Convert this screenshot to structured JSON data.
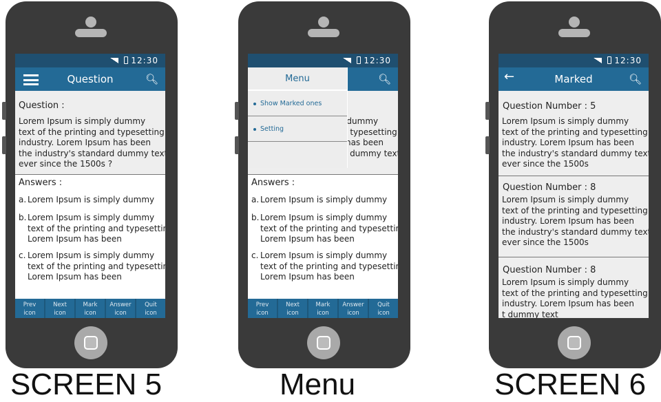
{
  "status": {
    "time": "12:30"
  },
  "screen5": {
    "title": "Question",
    "question_heading": "Question :",
    "question_lines": [
      "Lorem Ipsum is simply dummy",
      "text of the printing and typesetting",
      "industry. Lorem Ipsum has been",
      "the industry's standard dummy text",
      "ever since the 1500s ?"
    ],
    "answers_heading": "Answers :",
    "answers": [
      {
        "letter": "a.",
        "lines": [
          "Lorem Ipsum is simply dummy"
        ]
      },
      {
        "letter": "b.",
        "lines": [
          "Lorem Ipsum is simply dummy",
          "text of the printing and typesetting",
          "Lorem Ipsum has been"
        ]
      },
      {
        "letter": "c.",
        "lines": [
          "Lorem Ipsum is simply dummy",
          "text of the printing and typesetting",
          "Lorem Ipsum has been"
        ]
      }
    ],
    "nav": [
      [
        "Prev",
        "icon"
      ],
      [
        "Next",
        "icon"
      ],
      [
        "Mark",
        "icon"
      ],
      [
        "Answer",
        "icon"
      ],
      [
        "Quit",
        "icon"
      ]
    ],
    "caption": "SCREEN 5"
  },
  "menu": {
    "title": "Menu",
    "items": [
      "Show Marked ones",
      "Setting"
    ],
    "caption": "Menu"
  },
  "screen6": {
    "title": "Marked",
    "items": [
      {
        "heading": "Question Number : 5",
        "lines": [
          "Lorem Ipsum is simply dummy",
          "text of the printing and typesetting",
          "industry. Lorem Ipsum has been",
          "the industry's standard dummy text",
          "ever since the 1500s"
        ]
      },
      {
        "heading": "Question Number : 8",
        "lines": [
          "Lorem Ipsum is simply dummy",
          "text of the printing and typesetting",
          "industry. Lorem Ipsum has been",
          "the industry's standard dummy text",
          "ever since the 1500s"
        ]
      },
      {
        "heading": "Question Number : 8",
        "lines": [
          "Lorem Ipsum is simply dummy",
          "text of the printing and typesetting",
          "industry. Lorem Ipsum has been",
          "t dummy text"
        ]
      }
    ],
    "caption": "SCREEN 6"
  },
  "colors": {
    "status_bar": "#1f4f70",
    "header": "#236a96",
    "content": "#eeeeee",
    "phone": "#3a3a3a"
  }
}
